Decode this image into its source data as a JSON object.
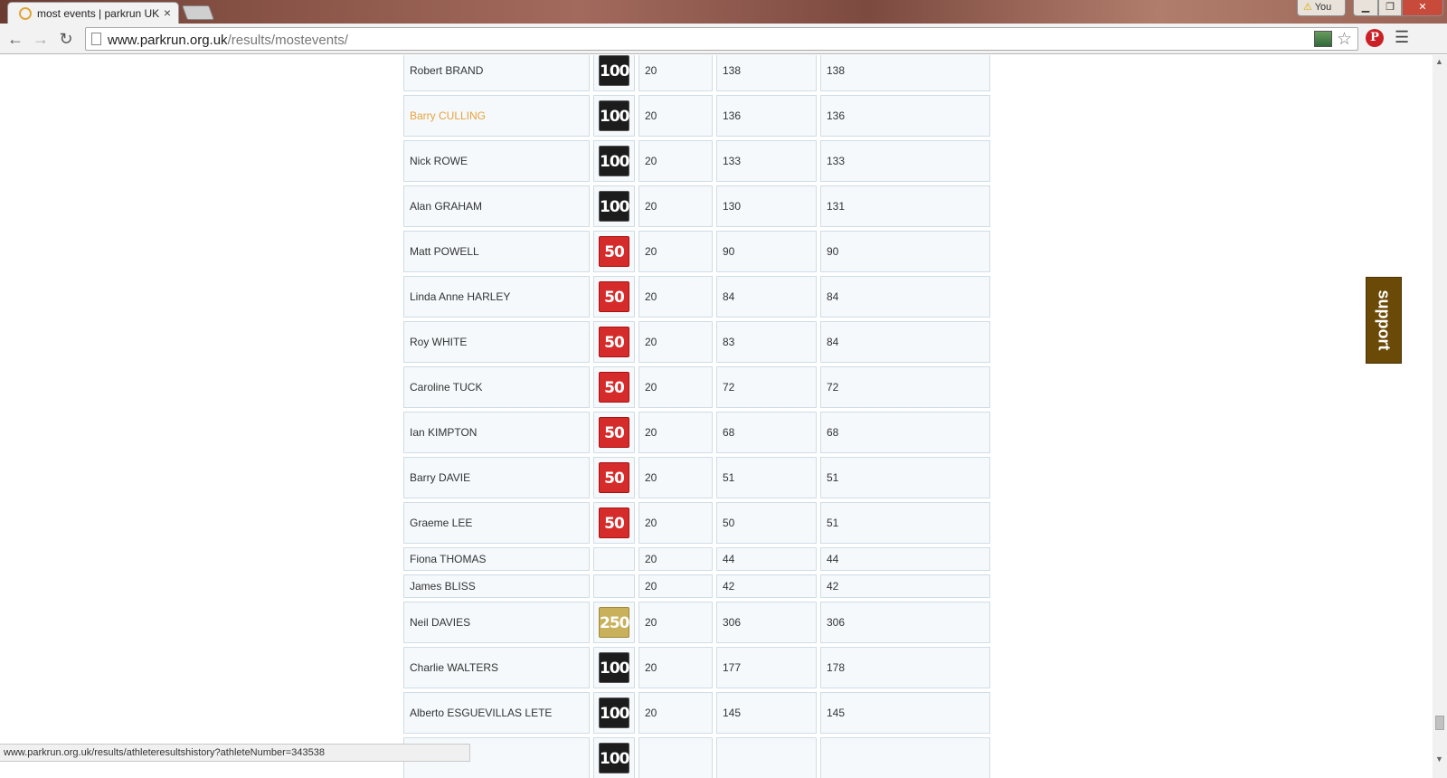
{
  "browser": {
    "tab_title": "most events | parkrun UK",
    "tab_close": "×",
    "profile_label": "You",
    "url_host": "www.parkrun.org.uk",
    "url_path": "/results/mostevents/",
    "status_url": "www.parkrun.org.uk/results/athleteresultshistory?athleteNumber=343538"
  },
  "support_label": "support",
  "rows": [
    {
      "name": "Robert BRAND",
      "badge": "100",
      "badge_class": "m100",
      "events": "20",
      "total": "138",
      "overall": "138",
      "size": "tall"
    },
    {
      "name": "Barry CULLING",
      "badge": "100",
      "badge_class": "m100",
      "events": "20",
      "total": "136",
      "overall": "136",
      "size": "tall",
      "hover": true
    },
    {
      "name": "Nick ROWE",
      "badge": "100",
      "badge_class": "m100",
      "events": "20",
      "total": "133",
      "overall": "133",
      "size": "tall"
    },
    {
      "name": "Alan GRAHAM",
      "badge": "100",
      "badge_class": "m100",
      "events": "20",
      "total": "130",
      "overall": "131",
      "size": "tall"
    },
    {
      "name": "Matt POWELL",
      "badge": "50",
      "badge_class": "m50",
      "events": "20",
      "total": "90",
      "overall": "90",
      "size": "tall"
    },
    {
      "name": "Linda Anne HARLEY",
      "badge": "50",
      "badge_class": "m50",
      "events": "20",
      "total": "84",
      "overall": "84",
      "size": "tall"
    },
    {
      "name": "Roy WHITE",
      "badge": "50",
      "badge_class": "m50",
      "events": "20",
      "total": "83",
      "overall": "84",
      "size": "tall"
    },
    {
      "name": "Caroline TUCK",
      "badge": "50",
      "badge_class": "m50",
      "events": "20",
      "total": "72",
      "overall": "72",
      "size": "tall"
    },
    {
      "name": "Ian KIMPTON",
      "badge": "50",
      "badge_class": "m50",
      "events": "20",
      "total": "68",
      "overall": "68",
      "size": "tall"
    },
    {
      "name": "Barry DAVIE",
      "badge": "50",
      "badge_class": "m50",
      "events": "20",
      "total": "51",
      "overall": "51",
      "size": "tall"
    },
    {
      "name": "Graeme LEE",
      "badge": "50",
      "badge_class": "m50",
      "events": "20",
      "total": "50",
      "overall": "51",
      "size": "tall"
    },
    {
      "name": "Fiona THOMAS",
      "badge": "",
      "badge_class": "",
      "events": "20",
      "total": "44",
      "overall": "44",
      "size": "short"
    },
    {
      "name": "James BLISS",
      "badge": "",
      "badge_class": "",
      "events": "20",
      "total": "42",
      "overall": "42",
      "size": "short"
    },
    {
      "name": "Neil DAVIES",
      "badge": "250",
      "badge_class": "m250",
      "events": "20",
      "total": "306",
      "overall": "306",
      "size": "tall"
    },
    {
      "name": "Charlie WALTERS",
      "badge": "100",
      "badge_class": "m100",
      "events": "20",
      "total": "177",
      "overall": "178",
      "size": "tall"
    },
    {
      "name": "Alberto ESGUEVILLAS LETE",
      "badge": "100",
      "badge_class": "m100",
      "events": "20",
      "total": "145",
      "overall": "145",
      "size": "tall"
    },
    {
      "name": "",
      "badge": "100",
      "badge_class": "m100",
      "events": "",
      "total": "",
      "overall": "",
      "size": "tall"
    }
  ]
}
